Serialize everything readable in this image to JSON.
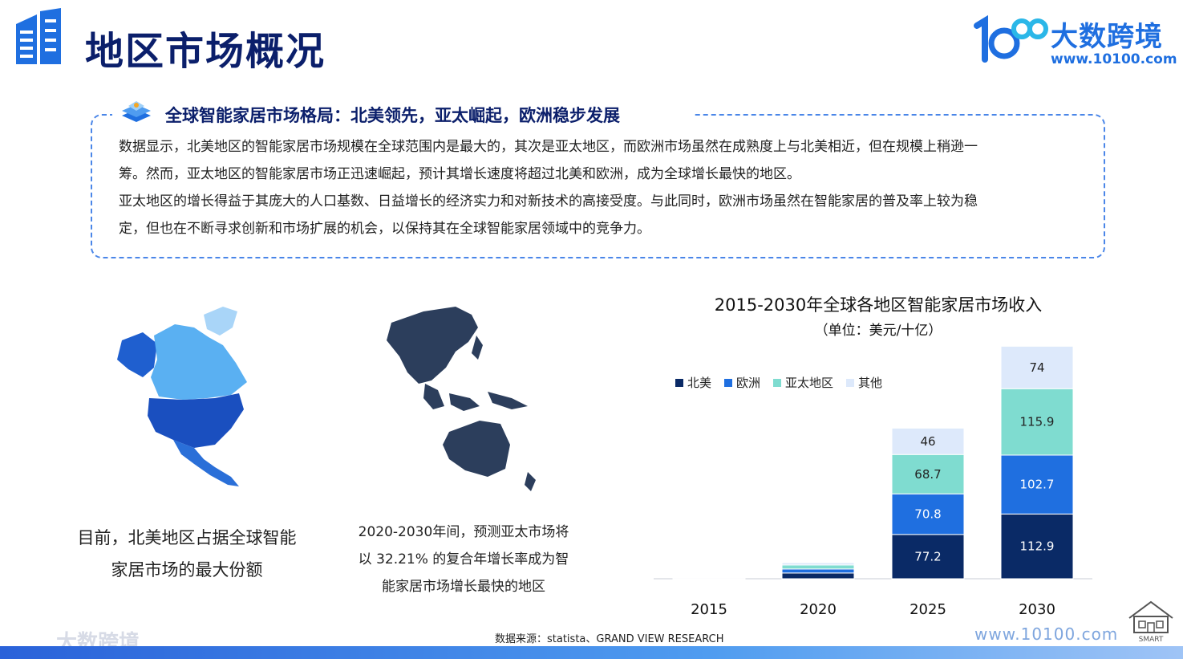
{
  "header": {
    "title": "地区市场概况",
    "brand_name": "大数跨境",
    "brand_url": "www.10100.com"
  },
  "summary": {
    "heading": "全球智能家居市场格局：北美领先，亚太崛起，欧洲稳步发展",
    "lines": [
      "数据显示，北美地区的智能家居市场规模在全球范围内是最大的，其次是亚太地区，而欧洲市场虽然在成熟度上与北美相近，但在规模上稍逊一",
      "筹。然而，亚太地区的智能家居市场正迅速崛起，预计其增长速度将超过北美和欧洲，成为全球增长最快的地区。",
      "亚太地区的增长得益于其庞大的人口基数、日益增长的经济实力和对新技术的高接受度。与此同时，欧洲市场虽然在智能家居的普及率上较为稳",
      "定，但也在不断寻求创新和市场扩展的机会，以保持其在全球智能家居领域中的竞争力。"
    ]
  },
  "left_caption": {
    "line1": "目前，北美地区占据全球智能",
    "line2": "家居市场的最大份额"
  },
  "mid_caption": {
    "line1": "2020-2030年间，预测亚太市场将",
    "line2": "以 32.21% 的复合年增长率成为智",
    "line3": "能家居市场增长最快的地区"
  },
  "chart_data": {
    "type": "bar",
    "stacked": true,
    "title": "2015-2030年全球各地区智能家居市场收入",
    "subtitle": "（单位：美元/十亿）",
    "categories": [
      "2015",
      "2020",
      "2025",
      "2030"
    ],
    "series": [
      {
        "name": "北美",
        "color": "#0a2a66",
        "values": [
          1.5,
          10,
          77.2,
          112.9
        ],
        "labels": [
          "",
          "",
          "77.2",
          "112.9"
        ]
      },
      {
        "name": "欧洲",
        "color": "#1f6fe0",
        "values": [
          1,
          7,
          70.8,
          102.7
        ],
        "labels": [
          "",
          "",
          "70.8",
          "102.7"
        ]
      },
      {
        "name": "亚太地区",
        "color": "#7fdcd0",
        "values": [
          1,
          7,
          68.7,
          115.9
        ],
        "labels": [
          "",
          "",
          "68.7",
          "115.9"
        ]
      },
      {
        "name": "其他",
        "color": "#dde9fb",
        "values": [
          0.5,
          4,
          46,
          74
        ],
        "labels": [
          "",
          "",
          "46",
          "74"
        ]
      }
    ],
    "ylim": [
      0,
      406
    ],
    "legend_position": "top-left",
    "grid": false
  },
  "source": "数据来源：statista、GRAND VIEW RESEARCH",
  "watermark": {
    "url": "www.10100.com",
    "brand": "大数跨境",
    "smart_badge": "SMART"
  },
  "colors": {
    "primary": "#0b1f6b",
    "accent": "#1f6fe0",
    "map_dark": "#2c3e5c"
  },
  "icons": [
    "building-logo-icon",
    "brand-logo-icon",
    "layer-stack-icon",
    "smart-home-badge-icon"
  ]
}
